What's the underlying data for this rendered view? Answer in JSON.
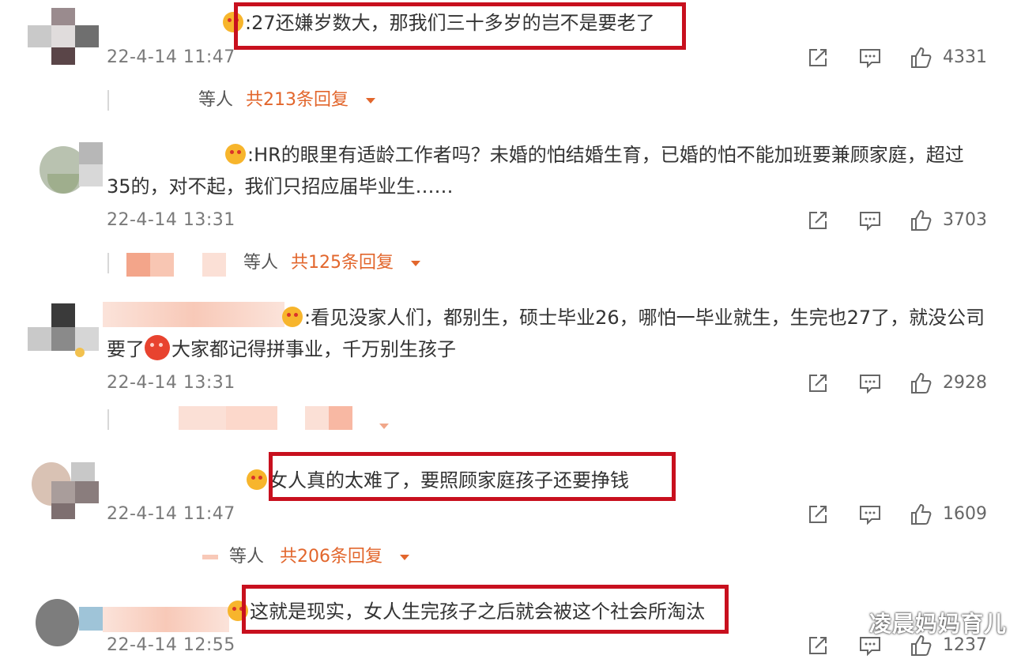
{
  "comments": [
    {
      "text": ":27还嫌岁数大，那我们三十多岁的岂不是要老了",
      "time": "22-4-14 11:47",
      "likes": "4331",
      "reply_who": "等人",
      "reply_count": "共213条回复"
    },
    {
      "text_line1": ":HR的眼里有适龄工作者吗？未婚的怕结婚生育，已婚的怕不能加班要兼顾家庭，超过",
      "text_line2": "35的，对不起，我们只招应届毕业生……",
      "time": "22-4-14 13:31",
      "likes": "3703",
      "reply_who": "等人",
      "reply_count": "共125条回复"
    },
    {
      "text_line1": ":看见没家人们，都别生，硕士毕业26，哪怕一毕业就生，生完也27了，就没公司",
      "text_line2a": "要了",
      "text_line2b": "大家都记得拼事业，千万别生孩子",
      "time": "22-4-14 13:31",
      "likes": "2928"
    },
    {
      "text": "女人真的太难了，要照顾家庭孩子还要挣钱",
      "time": "22-4-14 11:47",
      "likes": "1609",
      "reply_who": "等人",
      "reply_count": "共206条回复"
    },
    {
      "text": "这就是现实，女人生完孩子之后就会被这个社会所淘汰",
      "time": "22-4-14 12:55",
      "likes": "1237"
    }
  ],
  "icons": {
    "share": "share-icon",
    "comment": "comment-icon",
    "like": "thumbs-up-icon",
    "dropdown": "chevron-down-icon",
    "emoji": "emoji-icon"
  },
  "colors": {
    "highlight": "#c8101e",
    "reply_count": "#e2662c",
    "timestamp": "#7a7a7a"
  },
  "watermark": "凌晨妈妈育儿"
}
